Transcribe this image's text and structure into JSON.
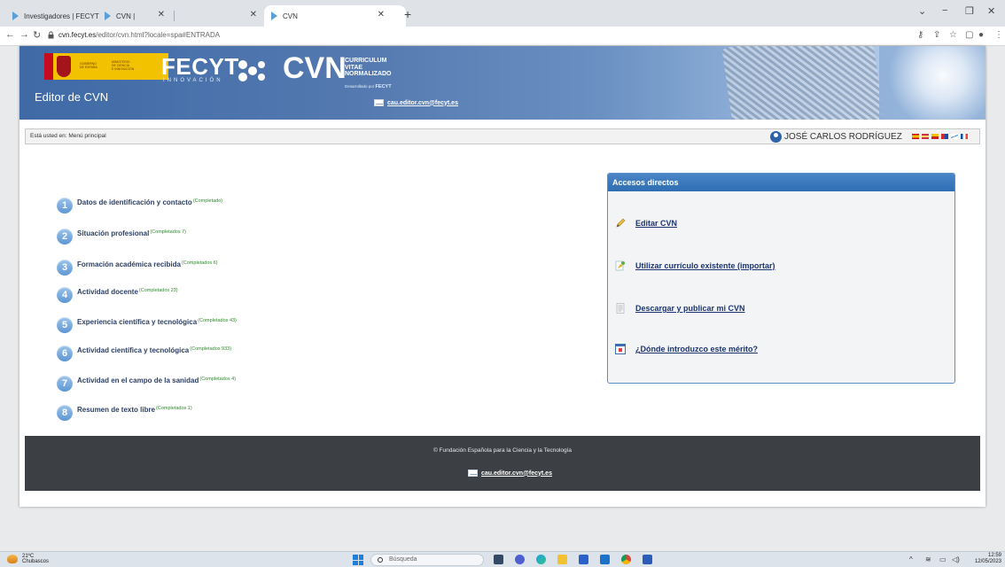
{
  "browser": {
    "tabs": [
      {
        "title": "Investigadores | FECYT",
        "active": false
      },
      {
        "title": "CVN |",
        "active": false
      },
      {
        "title": "CVN",
        "active": true
      }
    ],
    "url_domain": "cvn.fecyt.es",
    "url_path": "/editor/cvn.html?locale=spa#ENTRADA"
  },
  "banner": {
    "gov_text": "GOBIERNO\nDE ESPAÑA",
    "ministry_text": "MINISTERIO\nDE CIENCIA\nE INNOVACIÓN",
    "fecyt": "FECYT",
    "innovacion": "INNOVACIÓN",
    "cvn": "CVN",
    "cvn_sub": [
      "CURRICULUM",
      "VITAE",
      "NORMALIZADO"
    ],
    "cvn_small": "Desarrollado por",
    "cvn_small_brand": "FECYT",
    "title": "Editor de CVN",
    "email": "cau.editor.cvn@fecyt.es"
  },
  "breadcrumb": {
    "text": "Está usted en: Menú principal",
    "user": "JOSÉ CARLOS RODRÍGUEZ"
  },
  "menu": [
    {
      "num": "1",
      "label": "Datos de identificación y contacto",
      "status": "(Completado)"
    },
    {
      "num": "2",
      "label": "Situación profesional",
      "status": "(Completados 7)"
    },
    {
      "num": "3",
      "label": "Formación académica recibida",
      "status": "(Completados 6)"
    },
    {
      "num": "4",
      "label": "Actividad docente",
      "status": "(Completados 23)"
    },
    {
      "num": "5",
      "label": "Experiencia científica y tecnológica",
      "status": "(Completados 43)"
    },
    {
      "num": "6",
      "label": "Actividad científica y tecnológica",
      "status": "(Completados 933)"
    },
    {
      "num": "7",
      "label": "Actividad en el campo de la sanidad",
      "status": "(Completados 4)"
    },
    {
      "num": "8",
      "label": "Resumen de texto libre",
      "status": "(Completados 1)"
    }
  ],
  "accesos": {
    "title": "Accesos directos",
    "links": [
      {
        "label": "Editar CVN",
        "icon": "pencil-icon"
      },
      {
        "label": "Utilizar currículo existente (importar)",
        "icon": "import-icon"
      },
      {
        "label": "Descargar y publicar mi CVN",
        "icon": "document-icon"
      },
      {
        "label": "¿Dónde introduzco este mérito?",
        "icon": "help-window-icon"
      }
    ]
  },
  "footer": {
    "copyright": "© Fundación Española para la Ciencia y la Tecnología",
    "email": "cau.editor.cvn@fecyt.es"
  },
  "taskbar": {
    "temp": "21ºC",
    "weather": "Chubascos",
    "search": "Búsqueda",
    "time": "12:59",
    "date": "12/05/2023"
  },
  "colors": {
    "banner_blue": "#3f6aa6",
    "panel_header": "#2f6eb3",
    "link": "#1b3470",
    "status_green": "#2e8b2e",
    "footer": "#3c3f44"
  }
}
